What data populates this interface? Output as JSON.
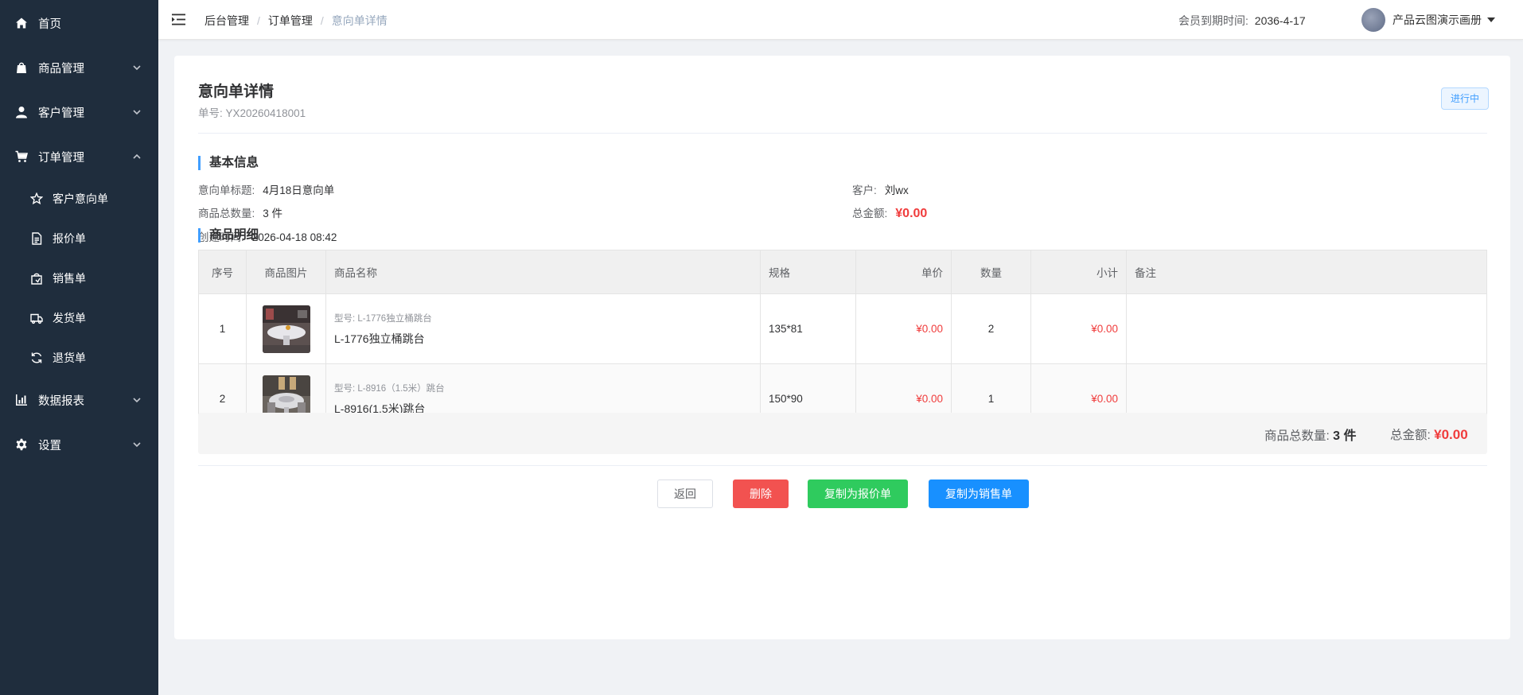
{
  "sidebar": {
    "items": [
      {
        "label": "首页",
        "icon": "home-icon"
      },
      {
        "label": "商品管理",
        "icon": "shopping-bag-icon"
      },
      {
        "label": "客户管理",
        "icon": "user-icon"
      },
      {
        "label": "订单管理",
        "icon": "cart-icon"
      },
      {
        "label": "数据报表",
        "icon": "bar-chart-icon"
      },
      {
        "label": "设置",
        "icon": "gear-icon"
      }
    ],
    "sub_items": [
      {
        "label": "客户意向单",
        "icon": "star-icon"
      },
      {
        "label": "报价单",
        "icon": "document-icon"
      },
      {
        "label": "销售单",
        "icon": "bag-icon"
      },
      {
        "label": "发货单",
        "icon": "truck-icon"
      },
      {
        "label": "退货单",
        "icon": "refresh-icon"
      }
    ]
  },
  "header": {
    "breadcrumb": [
      "后台管理",
      "订单管理",
      "意向单详情"
    ],
    "breadcrumb_sep": "/",
    "member_label": "会员到期时间:",
    "member_value": "2036-4-17",
    "user_name": "产品云图演示画册"
  },
  "detail": {
    "title": "意向单详情",
    "order_no": "单号: YX20260418001",
    "status": "进行中",
    "section_basic": "基本信息",
    "section_items": "商品明细",
    "basic": {
      "title_label": "意向单标题:",
      "title_value": "4月18日意向单",
      "qty_label": "商品总数量:",
      "qty_value": "3 件",
      "created_label": "创建时间:",
      "created_value": "2026-04-18 08:42",
      "customer_label": "客户:",
      "customer_value": "刘wx",
      "amount_label": "总金额:",
      "amount_value": "¥0.00"
    },
    "table": {
      "headers": [
        "序号",
        "商品图片",
        "商品名称",
        "规格",
        "单价",
        "数量",
        "小计",
        "备注"
      ],
      "rows": [
        {
          "no": "1",
          "model": "型号: L-1776独立桶跳台",
          "name": "L-1776独立桶跳台",
          "spec": "135*81",
          "price": "¥0.00",
          "qty": "2",
          "subtotal": "¥0.00",
          "note": ""
        },
        {
          "no": "2",
          "model": "型号: L-8916（1.5米）跳台",
          "name": "L-8916(1.5米)跳台",
          "spec": "150*90",
          "price": "¥0.00",
          "qty": "1",
          "subtotal": "¥0.00",
          "note": ""
        }
      ]
    },
    "summary": {
      "qty_label": "商品总数量:",
      "qty_value": "3 件",
      "amount_label": "总金额:",
      "amount_value": "¥0.00"
    },
    "buttons": {
      "back": "返回",
      "delete": "删除",
      "copy_quote": "复制为报价单",
      "copy_sale": "复制为销售单"
    }
  },
  "colors": {
    "sidebar_bg": "#1f2d3d",
    "primary": "#1890ff",
    "danger": "#f25250",
    "success": "#2fcb5e",
    "money": "#f03c3c"
  }
}
